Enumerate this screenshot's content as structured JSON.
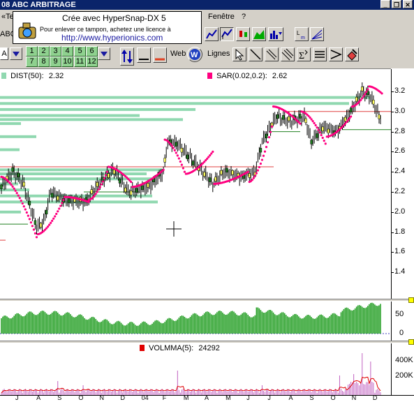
{
  "window": {
    "title": "08  ABC ARBITRAGE"
  },
  "menu": {
    "left_fragment": "«Te",
    "fenetre": "Fenêtre",
    "help": "?"
  },
  "stamp": {
    "line1": "Crée avec HyperSnap-DX 5",
    "line2": "Pour enlever ce tampon, achetez une licence à",
    "line3": "http://www.hyperionics.com"
  },
  "toolbar": {
    "abc_fragment": "ABC",
    "a_label": "A",
    "web_label": "Web",
    "lignes_label": "Lignes",
    "numbers_top": [
      "1",
      "2",
      "3",
      "4",
      "5",
      "6"
    ],
    "numbers_bottom": [
      "7",
      "8",
      "9",
      "10",
      "11",
      "12"
    ]
  },
  "indicators": {
    "dist": {
      "label": "DIST(50):",
      "value": "2.32",
      "color": "#90d8b0"
    },
    "sar": {
      "label": "SAR(0.02,0.2):",
      "value": "2.62",
      "color": "#ff0080"
    },
    "volmma": {
      "label": "VOLMMA(5):",
      "value": "24292",
      "color": "#e00000"
    }
  },
  "price_axis": [
    "3.2",
    "3.0",
    "2.8",
    "2.6",
    "2.4",
    "2.2",
    "2.0",
    "1.8",
    "1.6",
    "1.4"
  ],
  "oscillator_axis": [
    "50",
    "0"
  ],
  "volume_axis": [
    "400K",
    "200K"
  ],
  "x_axis_months": [
    "J",
    "A",
    "S",
    "O",
    "N",
    "D",
    "04",
    "F",
    "M",
    "A",
    "M",
    "J",
    "J",
    "A",
    "S",
    "O",
    "N",
    "D"
  ],
  "colors": {
    "accent": "#0a246a",
    "candle": "#000000",
    "sar": "#ff0080",
    "bars": "#28a028",
    "volume": "#c060c0"
  }
}
